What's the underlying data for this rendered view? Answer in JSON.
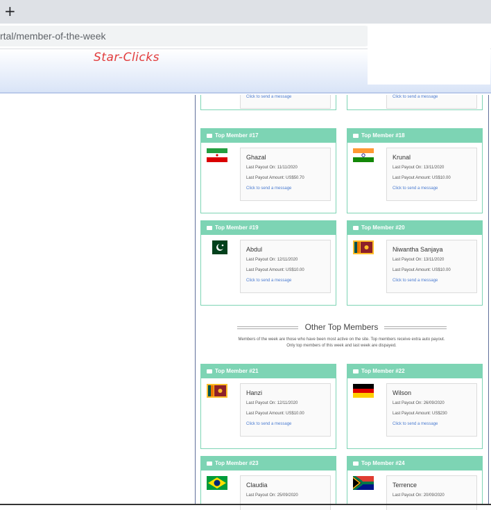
{
  "browser": {
    "new_tab": "+",
    "url": "rtal/member-of-the-week"
  },
  "site": {
    "logo": "Star-Clicks"
  },
  "top_partial": [
    {
      "message": "Click to send a message"
    },
    {
      "message": "Click to send a message"
    }
  ],
  "section": {
    "title": "Other Top Members",
    "desc_line1": "Members of the week are those who have been most active on the site. Top members receive extra auto payout.",
    "desc_line2": "Only top members of this week and last week are dispayed."
  },
  "cards": [
    {
      "header": "Top Member #17",
      "flag": "iran-flag",
      "name": "Ghazal",
      "payout_on": "Last Payout On: 11/11/2020",
      "payout_amount": "Last Payout Amount: US$50.70",
      "message": "Click to send a message"
    },
    {
      "header": "Top Member #18",
      "flag": "india-flag",
      "name": "Krunal",
      "payout_on": "Last Payout On: 13/11/2020",
      "payout_amount": "Last Payout Amount: US$10.00",
      "message": "Click to send a message"
    },
    {
      "header": "Top Member #19",
      "flag": "pakistan-flag",
      "name": "Abdul",
      "payout_on": "Last Payout On: 12/11/2020",
      "payout_amount": "Last Payout Amount: US$10.00",
      "message": "Click to send a message"
    },
    {
      "header": "Top Member #20",
      "flag": "sri-lanka-flag",
      "name": "Niwantha Sanjaya",
      "payout_on": "Last Payout On: 13/11/2020",
      "payout_amount": "Last Payout Amount: US$10.00",
      "message": "Click to send a message"
    },
    {
      "header": "Top Member #21",
      "flag": "sri-lanka-flag",
      "name": "Hanzi",
      "payout_on": "Last Payout On: 12/11/2020",
      "payout_amount": "Last Payout Amount: US$10.00",
      "message": "Click to send a message"
    },
    {
      "header": "Top Member #22",
      "flag": "germany-flag",
      "name": "Wilson",
      "payout_on": "Last Payout On: 26/09/2020",
      "payout_amount": "Last Payout Amount: US$230",
      "message": "Click to send a message"
    },
    {
      "header": "Top Member #23",
      "flag": "brazil-flag",
      "name": "Claudia",
      "payout_on": "Last Payout On: 25/09/2020",
      "payout_amount": "",
      "message": ""
    },
    {
      "header": "Top Member #24",
      "flag": "south-africa-flag",
      "name": "Terrence",
      "payout_on": "Last Payout On: 20/09/2020",
      "payout_amount": "",
      "message": ""
    }
  ]
}
